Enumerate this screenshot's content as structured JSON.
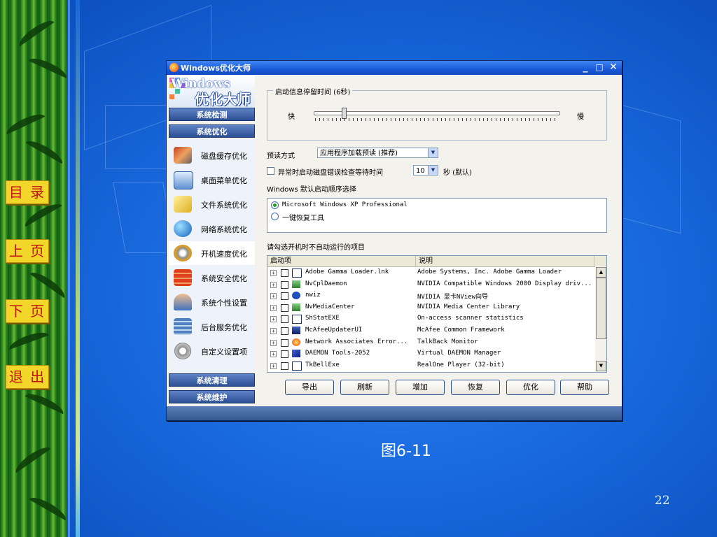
{
  "slide": {
    "nav": [
      "目 录",
      "上 页",
      "下 页",
      "退 出"
    ],
    "caption": "图6-11",
    "page_number": "22"
  },
  "window": {
    "title": "Windows优化大师",
    "controls": {
      "minimize": "_",
      "maximize": "□",
      "close": "✕"
    }
  },
  "logo": {
    "en": "Windows",
    "cn": "优化大师"
  },
  "sidebar": {
    "sections": [
      "系统检测",
      "系统优化"
    ],
    "items": [
      {
        "label": "磁盘缓存优化",
        "icon": "disk-cache-icon"
      },
      {
        "label": "桌面菜单优化",
        "icon": "desktop-menu-icon"
      },
      {
        "label": "文件系统优化",
        "icon": "file-system-icon"
      },
      {
        "label": "网络系统优化",
        "icon": "network-icon"
      },
      {
        "label": "开机速度优化",
        "icon": "boot-speed-icon"
      },
      {
        "label": "系统安全优化",
        "icon": "security-icon"
      },
      {
        "label": "系统个性设置",
        "icon": "personalize-icon"
      },
      {
        "label": "后台服务优化",
        "icon": "service-icon"
      },
      {
        "label": "自定义设置项",
        "icon": "custom-settings-icon"
      }
    ],
    "active_index": 4,
    "bottom_sections": [
      "系统清理",
      "系统维护"
    ]
  },
  "boot_message": {
    "group_label": "启动信息停留时间 (6秒)",
    "fast": "快",
    "slow": "慢",
    "slider_value_fraction": 0.12
  },
  "prefetch": {
    "label": "预读方式",
    "value": "应用程序加载预读 (推荐)"
  },
  "disk_check": {
    "label": "异常时启动磁盘错误检查等待时间",
    "value": "10",
    "suffix": "秒 (默认)",
    "checked": false
  },
  "boot_order": {
    "label": "Windows 默认启动顺序选择",
    "options": [
      "Microsoft Windows XP Professional",
      "一键恢复工具"
    ],
    "selected": 0
  },
  "startup_list": {
    "label": "请勾选开机时不自动运行的项目",
    "columns": [
      "启动项",
      "说明"
    ],
    "rows": [
      {
        "name": "Adobe Gamma Loader.lnk",
        "desc": "Adobe Systems, Inc. Adobe Gamma Loader"
      },
      {
        "name": "NvCplDaemon",
        "desc": "NVIDIA Compatible Windows 2000 Display driv..."
      },
      {
        "name": "nwiz",
        "desc": "NVIDIA 显卡NView向导"
      },
      {
        "name": "NvMediaCenter",
        "desc": "NVIDIA Media Center Library"
      },
      {
        "name": "ShStatEXE",
        "desc": "On-access scanner statistics"
      },
      {
        "name": "McAfeeUpdaterUI",
        "desc": "McAfee Common Framework"
      },
      {
        "name": "Network Associates Error...",
        "desc": "TalkBack Monitor"
      },
      {
        "name": "DAEMON Tools-2052",
        "desc": "Virtual DAEMON Manager"
      },
      {
        "name": "TkBellExe",
        "desc": "RealOne Player (32-bit)"
      }
    ]
  },
  "buttons": [
    "导出",
    "刷新",
    "增加",
    "恢复",
    "优化",
    "帮助"
  ]
}
